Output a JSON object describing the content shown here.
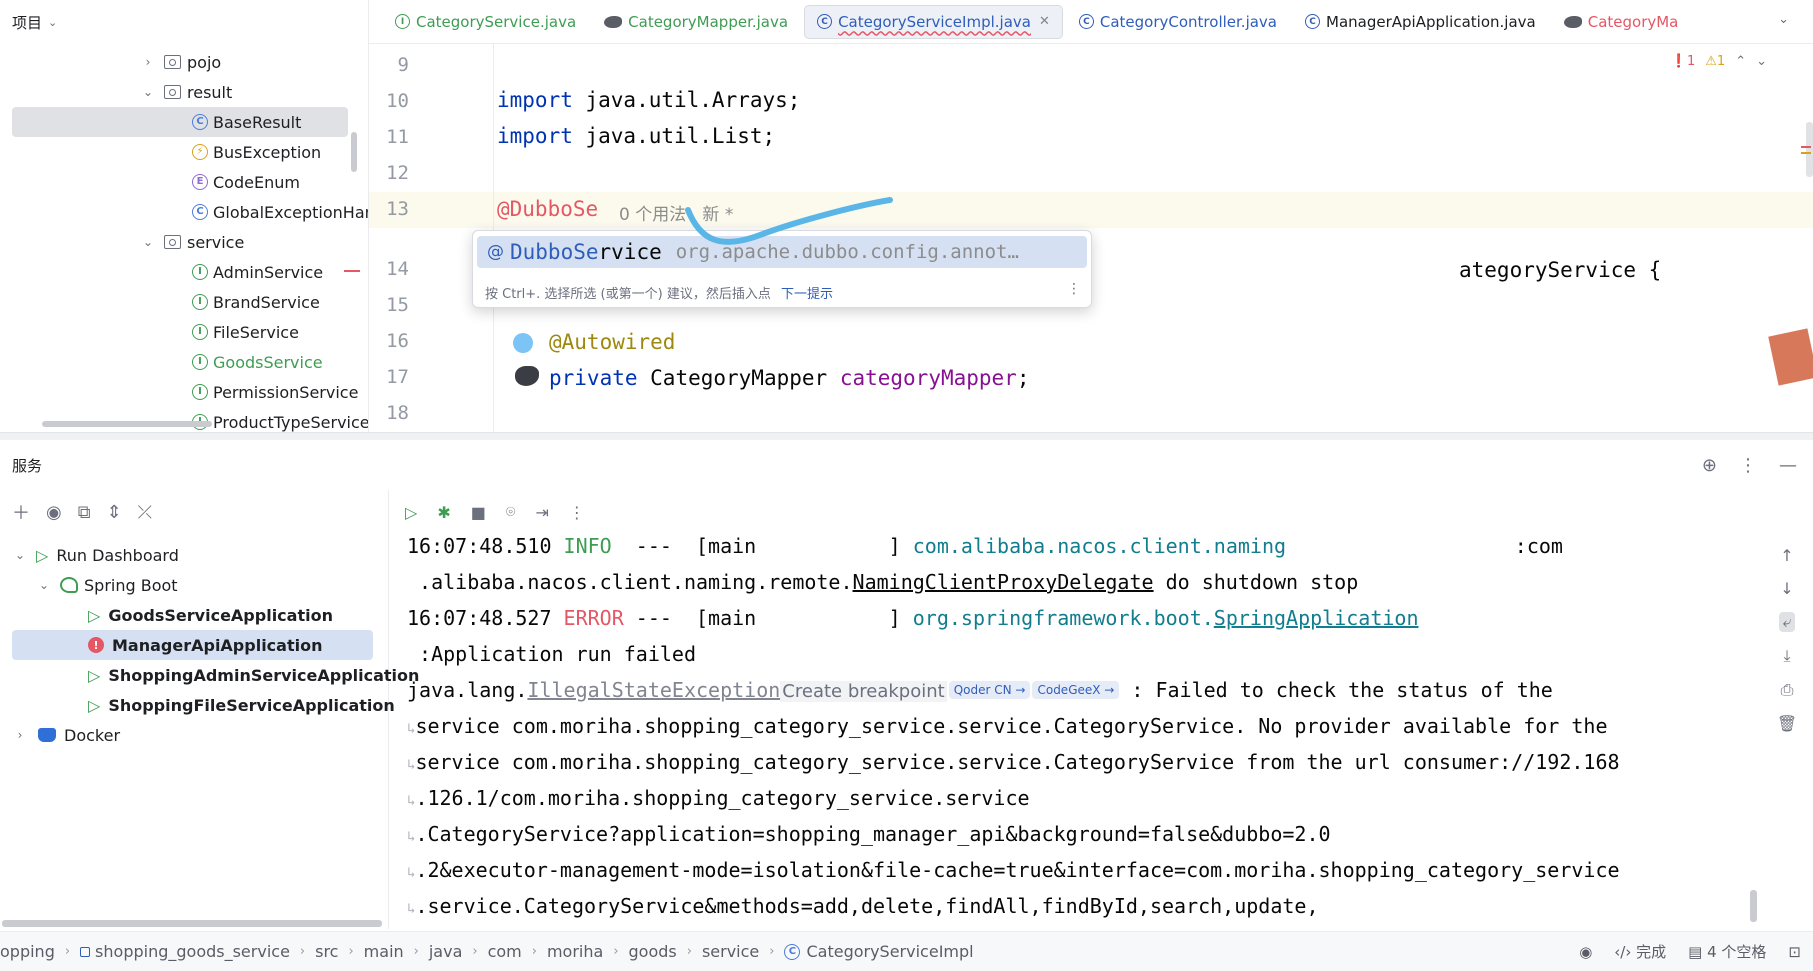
{
  "project": {
    "title": "项目",
    "tree": [
      {
        "label": "pojo"
      },
      {
        "label": "result"
      },
      {
        "label": "BaseResult"
      },
      {
        "label": "BusException"
      },
      {
        "label": "CodeEnum"
      },
      {
        "label": "GlobalExceptionHan"
      },
      {
        "label": "service"
      },
      {
        "label": "AdminService"
      },
      {
        "label": "BrandService"
      },
      {
        "label": "FileService"
      },
      {
        "label": "GoodsService"
      },
      {
        "label": "PermissionService"
      },
      {
        "label": "ProductTypeService"
      }
    ]
  },
  "tabs": [
    {
      "label": "CategoryService.java"
    },
    {
      "label": "CategoryMapper.java"
    },
    {
      "label": "CategoryServiceImpl.java"
    },
    {
      "label": "CategoryController.java"
    },
    {
      "label": "ManagerApiApplication.java"
    },
    {
      "label": "CategoryMa"
    }
  ],
  "inspections": {
    "errors": "1",
    "warnings": "1"
  },
  "editor": {
    "line_numbers": [
      "9",
      "10",
      "11",
      "12",
      "13",
      "14",
      "15",
      "16",
      "17",
      "18"
    ],
    "import_kw": "import",
    "line10_rest": " java.util.Arrays;",
    "line11_rest": " java.util.List;",
    "line13_annotation": "@DubboSe",
    "line13_hint": "0 个用法   新 *",
    "line14_rest": "ategoryService {",
    "line16_annotation": "@Autowired",
    "line17_kw": "private",
    "line17_type": " CategoryMapper ",
    "line17_field": "categoryMapper",
    "line17_end": ";"
  },
  "completion": {
    "at": "@",
    "match": "DubboSe",
    "rest": "rvice",
    "package": "org.apache.dubbo.config.annot…",
    "footer": "按 Ctrl+. 选择所选 (或第一个) 建议，然后插入点",
    "footer_link": "下一提示"
  },
  "services": {
    "title": "服务",
    "tree": [
      {
        "label": "Run Dashboard"
      },
      {
        "label": "Spring Boot"
      },
      {
        "label": "GoodsServiceApplication"
      },
      {
        "label": "ManagerApiApplication"
      },
      {
        "label": "ShoppingAdminServiceApplication"
      },
      {
        "label": "ShoppingFileServiceApplication"
      },
      {
        "label": "Docker"
      }
    ]
  },
  "console": {
    "l1_time": "16:07:48.510 ",
    "l1_level": "INFO",
    "l1_mid": "  ---  [main           ] ",
    "l1_logger": "com.alibaba.nacos.client.naming",
    "l1_end": "                   :com",
    "l2_pre": " .alibaba.nacos.client.naming.remote.",
    "l2_link": "NamingClientProxyDelegate",
    "l2_end": " do shutdown stop",
    "l3_time": "16:07:48.527 ",
    "l3_level": "ERROR",
    "l3_mid": " ---  [main           ] ",
    "l3_logger": "org.springframework.boot.",
    "l3_logger_link": "SpringApplication",
    "l4": " :Application run failed",
    "l5_pre": "java.lang.",
    "l5_link": "IllegalStateException",
    "breakpoint_hint": "Create breakpoint",
    "chip1": "Qoder CN →",
    "chip2": "CodeGeeX →",
    "l5_end": " : Failed to check the status of the",
    "l6": "service com.moriha.shopping_category_service.service.CategoryService. No provider available for the",
    "l7": "service com.moriha.shopping_category_service.service.CategoryService from the url consumer://192.168",
    "l8": ".126.1/com.moriha.shopping_category_service.service",
    "l9": ".CategoryService?application=shopping_manager_api&background=false&dubbo=2.0",
    "l10": ".2&executor-management-mode=isolation&file-cache=true&interface=com.moriha.shopping_category_service",
    "l11": ".service.CategoryService&methods=add,delete,findAll,findById,search,update,"
  },
  "statusbar": {
    "crumbs": [
      "opping",
      "shopping_goods_service",
      "src",
      "main",
      "java",
      "com",
      "moriha",
      "goods",
      "service",
      "CategoryServiceImpl"
    ],
    "status": "完成",
    "indent": "4 个空格"
  },
  "colors": {
    "accent": "#2f5dba",
    "error": "#e55765",
    "success": "#3e9d52"
  }
}
